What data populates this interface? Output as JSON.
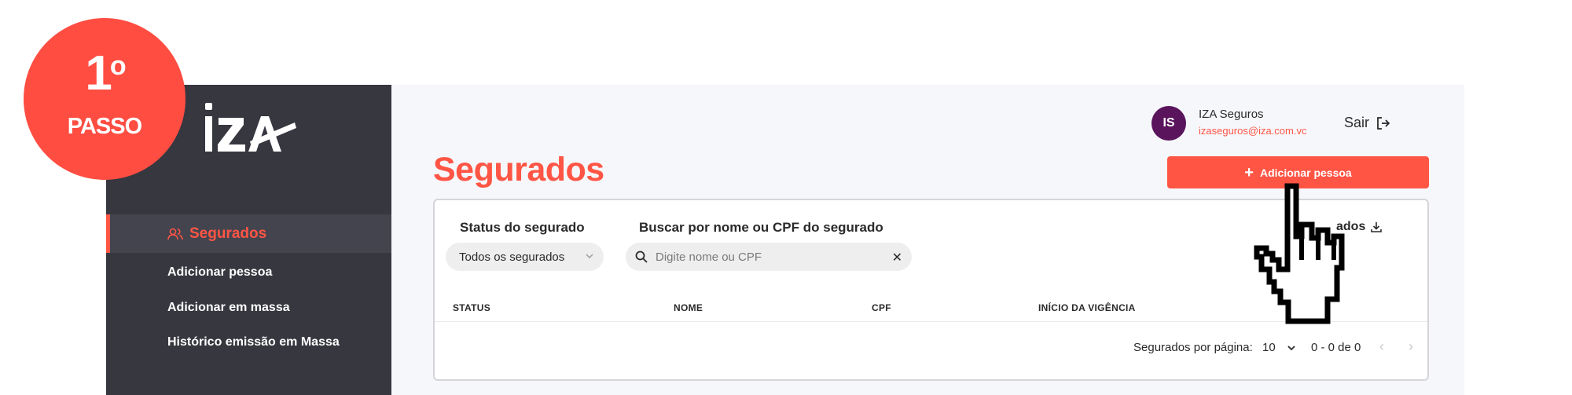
{
  "badge": {
    "number": "1",
    "ordinal": "o",
    "word": "PASSO"
  },
  "brand": {
    "logo_text": "iza",
    "accent": "#ff5545",
    "sidebar_bg": "#373740"
  },
  "sidebar": {
    "items": [
      {
        "label": "Segurados",
        "icon": "users-icon",
        "active": true
      },
      {
        "label": "Adicionar pessoa"
      },
      {
        "label": "Adicionar em massa"
      },
      {
        "label": "Histórico emissão em Massa"
      }
    ]
  },
  "header": {
    "avatar_initials": "IS",
    "user_name": "IZA Seguros",
    "user_email": "izaseguros@iza.com.vc",
    "logout_label": "Sair"
  },
  "main": {
    "title": "Segurados",
    "add_button_label": "Adicionar pessoa",
    "filters": {
      "status_label": "Status do segurado",
      "status_value": "Todos os segurados",
      "search_label": "Buscar por nome ou CPF do segurado",
      "search_placeholder": "Digite nome ou CPF",
      "search_value": ""
    },
    "export_label": "ados",
    "table": {
      "columns": [
        "STATUS",
        "NOME",
        "CPF",
        "INÍCIO DA VIGÊNCIA"
      ]
    },
    "pagination": {
      "per_page_label": "Segurados por página:",
      "per_page_value": "10",
      "range": "0 - 0 de 0"
    }
  }
}
